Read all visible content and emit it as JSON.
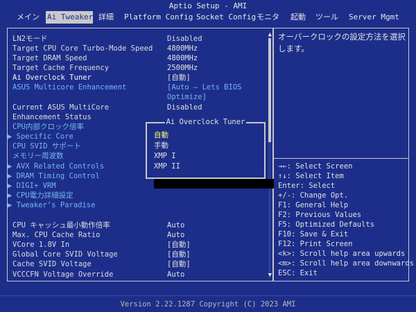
{
  "app_title": "Aptio Setup - AMI",
  "tabs": [
    {
      "label": "メイン"
    },
    {
      "label": "Ai Tweaker"
    },
    {
      "label": "詳細"
    },
    {
      "label": "Platform Config"
    },
    {
      "label": "Socket Config"
    },
    {
      "label": "モニタ"
    },
    {
      "label": "起動"
    },
    {
      "label": "ツール"
    },
    {
      "label": "Server Mgmt"
    }
  ],
  "main": {
    "rows": [
      {
        "label": "LN2モード",
        "value": "Disabled"
      },
      {
        "label": "Target CPU Core Turbo-Mode Speed",
        "value": "4800MHz"
      },
      {
        "label": "Target DRAM Speed",
        "value": "4800MHz"
      },
      {
        "label": "Target Cache Frequency",
        "value": "2500MHz"
      },
      {
        "label": "Ai Overclock Tuner",
        "value": "[自動]"
      },
      {
        "label": "ASUS Multicore Enhancement",
        "value": "[Auto – Lets BIOS",
        "value2": "Optimize]"
      },
      {
        "label": "Current ASUS MultiCore",
        "label2": "Enhancement Status",
        "value": "Disabled"
      },
      {
        "label": "CPU内部クロック倍率"
      },
      {
        "label": "Specific Core"
      },
      {
        "label": "CPU SVID サポート"
      },
      {
        "label": "メモリー周波数"
      },
      {
        "label": "AVX Related Controls"
      },
      {
        "label": "DRAM Timing Control"
      },
      {
        "label": "DIGI+ VRM"
      },
      {
        "label": "CPU電力詳細設定"
      },
      {
        "label": "Tweaker’s Paradise"
      },
      {
        "label": "CPU キャッシュ最小動作倍率",
        "value": "Auto"
      },
      {
        "label": "Max. CPU Cache Ratio",
        "value": "Auto"
      },
      {
        "label": "VCore 1.8V In",
        "value": "[自動]"
      },
      {
        "label": "Global Core SVID Voltage",
        "value": "[自動]"
      },
      {
        "label": "Cache SVID Voltage",
        "value": "[自動]"
      },
      {
        "label": "VCCCFN Voltage Override",
        "value": "Auto"
      }
    ]
  },
  "popup": {
    "title": "Ai Overclock Tuner",
    "options": [
      "自動",
      "手動",
      "XMP I",
      "XMP II"
    ],
    "selected_index": 0
  },
  "help": {
    "description": "オーバークロックの設定方法を選択します。",
    "keys": [
      "→←: Select Screen",
      "↑↓: Select Item",
      "Enter: Select",
      "+/-: Change Opt.",
      "F1: General Help",
      "F2: Previous Values",
      "F5: Optimized Defaults",
      "F10: Save & Exit",
      "F12: Print Screen",
      "<k>: Scroll help area upwards",
      "<m>: Scroll help area downwards",
      "ESC: Exit"
    ]
  },
  "footer": "Version 2.22.1287 Copyright (C) 2023 AMI",
  "colors": {
    "background": "#1D2E8A",
    "submenu_text": "#76B6F0",
    "selected_option": "#FFFF66"
  }
}
